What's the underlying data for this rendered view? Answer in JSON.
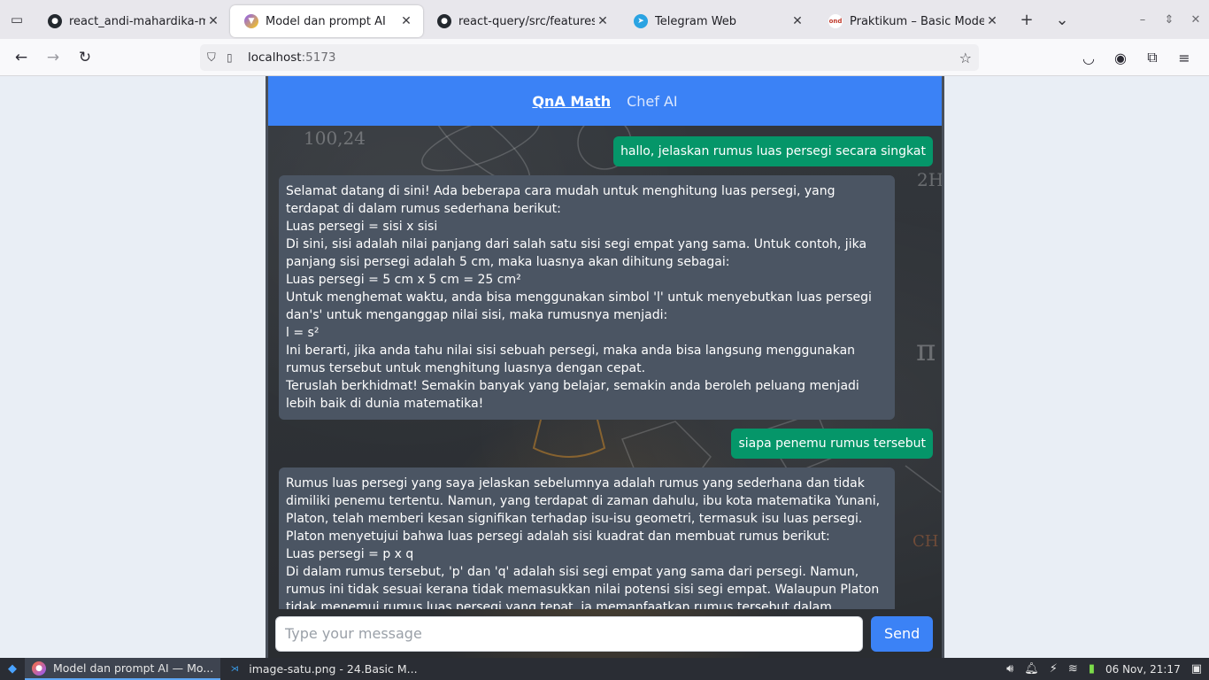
{
  "browser": {
    "tabs": [
      {
        "title": "react_andi-mahardika-mulya",
        "icon": "github-icon",
        "active": false
      },
      {
        "title": "Model dan prompt AI",
        "icon": "vite-icon",
        "active": true
      },
      {
        "title": "react-query/src/features/eve",
        "icon": "github-icon",
        "active": false
      },
      {
        "title": "Telegram Web",
        "icon": "telegram-icon",
        "active": false
      },
      {
        "title": "Praktikum – Basic Model Ope",
        "icon": "ond-icon",
        "active": false
      }
    ],
    "url_host": "localhost",
    "url_port": ":5173"
  },
  "app": {
    "nav": [
      {
        "label": "QnA Math",
        "active": true
      },
      {
        "label": "Chef AI",
        "active": false
      }
    ],
    "chalkboard": {
      "top_left": "100,24",
      "right_mid": "2H",
      "right_lower": "π",
      "right_bottom": "CH"
    },
    "messages": [
      {
        "role": "user",
        "text": "hallo, jelaskan rumus luas persegi secara singkat"
      },
      {
        "role": "ai",
        "lines": [
          "Selamat datang di sini! Ada beberapa cara mudah untuk menghitung luas persegi, yang terdapat di dalam rumus sederhana berikut:",
          "Luas persegi = sisi x sisi",
          "Di sini, sisi adalah nilai panjang dari salah satu sisi segi empat yang sama. Untuk contoh, jika panjang sisi persegi adalah 5 cm, maka luasnya akan dihitung sebagai:",
          "Luas persegi = 5 cm x 5 cm = 25 cm²",
          "Untuk menghemat waktu, anda bisa menggunakan simbol 'l' untuk menyebutkan luas persegi dan's' untuk menganggap nilai sisi, maka rumusnya menjadi:",
          "l = s²",
          "Ini berarti, jika anda tahu nilai sisi sebuah persegi, maka anda bisa langsung menggunakan rumus tersebut untuk menghitung luasnya dengan cepat.",
          "Teruslah berkhidmat! Semakin banyak yang belajar, semakin anda beroleh peluang menjadi lebih baik di dunia matematika!"
        ]
      },
      {
        "role": "user",
        "text": "siapa penemu rumus tersebut"
      },
      {
        "role": "ai",
        "lines": [
          "Rumus luas persegi yang saya jelaskan sebelumnya adalah rumus yang sederhana dan tidak dimiliki penemu tertentu. Namun, yang terdapat di zaman dahulu, ibu kota matematika Yunani, Platon, telah memberi kesan signifikan terhadap isu-isu geometri, termasuk isu luas persegi. Platon menyetujui bahwa luas persegi adalah sisi kuadrat dan membuat rumus berikut:",
          "Luas persegi = p x q",
          "Di dalam rumus tersebut, 'p' dan 'q' adalah sisi segi empat yang sama dari persegi. Namun, rumus ini tidak sesuai kerana tidak memasukkan nilai potensi sisi segi empat. Walaupun Platon tidak menemui rumus luas persegi yang tepat, ia memanfaatkan rumus tersebut dalam mempelajari dan memodelkan"
        ]
      }
    ],
    "input": {
      "placeholder": "Type your message",
      "value": ""
    },
    "send_label": "Send"
  },
  "taskbar": {
    "items": [
      {
        "label": "Model dan prompt AI — Mo...",
        "icon": "firefox-icon",
        "active": true
      },
      {
        "label": "image-satu.png - 24.Basic M...",
        "icon": "vscode-icon",
        "active": false
      }
    ],
    "clock": "06 Nov, 21:17"
  }
}
